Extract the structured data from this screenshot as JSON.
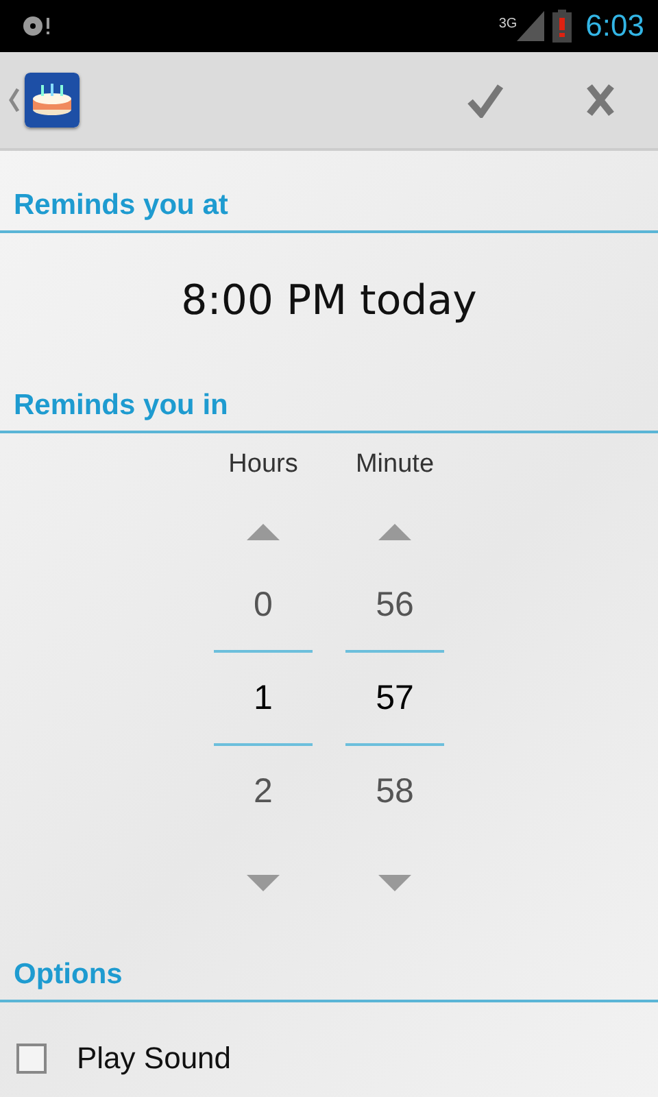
{
  "status_bar": {
    "network": "3G",
    "time": "6:03"
  },
  "action_bar": {
    "actions": [
      {
        "kind": "confirm"
      },
      {
        "kind": "cancel"
      }
    ]
  },
  "sections": [
    {
      "kind": "time",
      "title": "Reminds you at",
      "value": "8:00 PM today"
    },
    {
      "kind": "picker",
      "title": "Reminds you in",
      "columns": [
        {
          "label": "Hours",
          "values": [
            {
              "text": "0",
              "selected": false
            },
            {
              "text": "1",
              "selected": true
            },
            {
              "text": "2",
              "selected": false
            }
          ]
        },
        {
          "label": "Minute",
          "values": [
            {
              "text": "56",
              "selected": false
            },
            {
              "text": "57",
              "selected": true
            },
            {
              "text": "58",
              "selected": false
            }
          ]
        }
      ]
    },
    {
      "kind": "options",
      "title": "Options",
      "items": [
        {
          "label": "Play Sound",
          "checked": false
        }
      ]
    }
  ]
}
